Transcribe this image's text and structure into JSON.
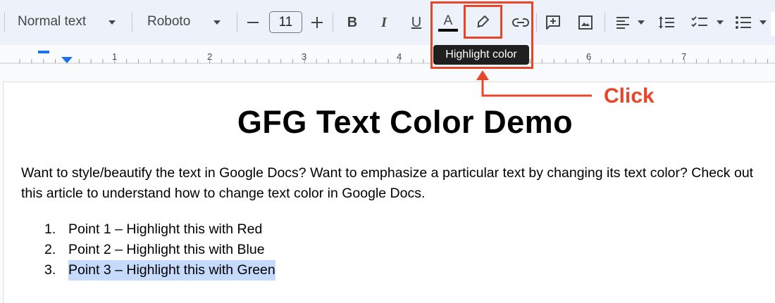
{
  "toolbar": {
    "style_label": "Normal text",
    "font_label": "Roboto",
    "font_size": "11",
    "bold_label": "B",
    "italic_label": "I",
    "underline_label": "U",
    "text_color_label": "A"
  },
  "ruler": {
    "numbers": [
      "1",
      "2",
      "3",
      "4",
      "6",
      "7"
    ]
  },
  "tooltip": {
    "text": "Highlight color"
  },
  "annotation": {
    "click_label": "Click",
    "color": "#e8462a"
  },
  "document": {
    "title": "GFG Text Color Demo",
    "paragraph": "Want to style/beautify the text in Google Docs? Want to emphasize a particular text by changing its text color? Check out this article to understand how to change text color in Google Docs.",
    "list": [
      {
        "num": "1.",
        "text": "Point 1 – Highlight this with Red"
      },
      {
        "num": "2.",
        "text": "Point 2 – Highlight this with Blue"
      },
      {
        "num": "3.",
        "text": "Point 3 – Highlight this with Green"
      }
    ],
    "highlight_color": "#c6dafc"
  }
}
